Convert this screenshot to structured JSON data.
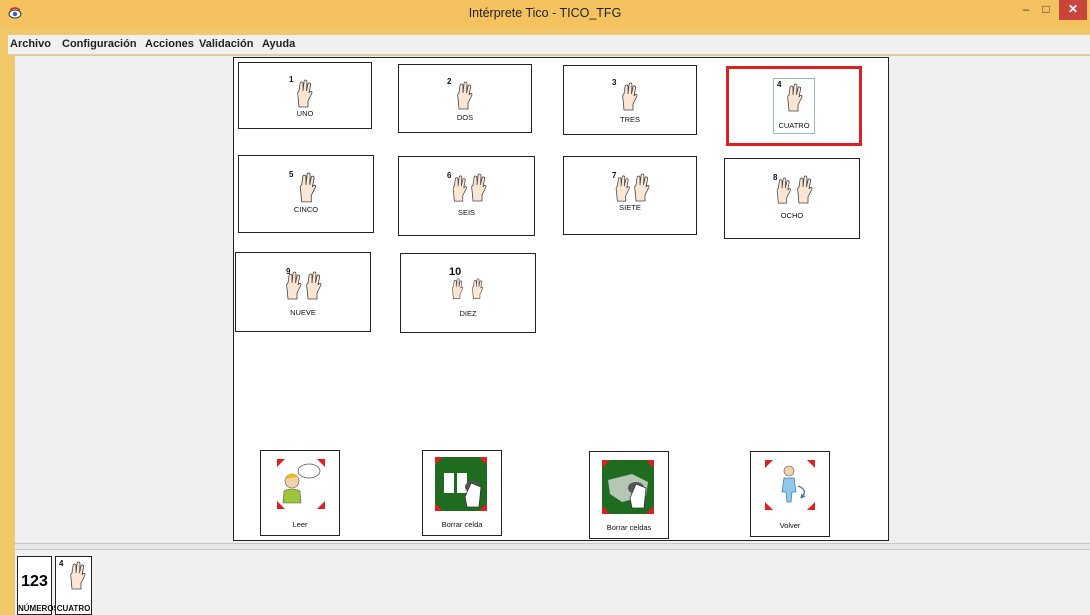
{
  "window": {
    "title": "Intérprete Tico - TICO_TFG",
    "minimize": "–",
    "maximize": "□",
    "close": "✕"
  },
  "menu": {
    "items": [
      "Archivo",
      "Configuración",
      "Acciones",
      "Validación",
      "Ayuda"
    ]
  },
  "board": {
    "cells": [
      {
        "number": "1",
        "label": "UNO"
      },
      {
        "number": "2",
        "label": "DOS"
      },
      {
        "number": "3",
        "label": "TRES"
      },
      {
        "number": "4",
        "label": "CUATRO"
      },
      {
        "number": "5",
        "label": "CINCO"
      },
      {
        "number": "6",
        "label": "SEIS"
      },
      {
        "number": "7",
        "label": "SIETE"
      },
      {
        "number": "8",
        "label": "OCHO"
      },
      {
        "number": "9",
        "label": "NUEVE"
      },
      {
        "number": "10",
        "label": "DIEZ"
      }
    ],
    "selected": "CUATRO",
    "actions": [
      {
        "label": "Leer",
        "icon": "read-aloud-icon"
      },
      {
        "label": "Borrar celda",
        "icon": "erase-cell-icon"
      },
      {
        "label": "Borrar celdas",
        "icon": "erase-cells-icon"
      },
      {
        "label": "Volver",
        "icon": "return-icon"
      }
    ]
  },
  "history": {
    "items": [
      {
        "label": "NÚMEROS",
        "text": "123"
      },
      {
        "label": "CUATRO",
        "number": "4"
      }
    ]
  },
  "colors": {
    "titlebar": "#f4c360",
    "selection": "#e02020",
    "action_green": "#1f6b1f",
    "close": "#c9443a"
  }
}
